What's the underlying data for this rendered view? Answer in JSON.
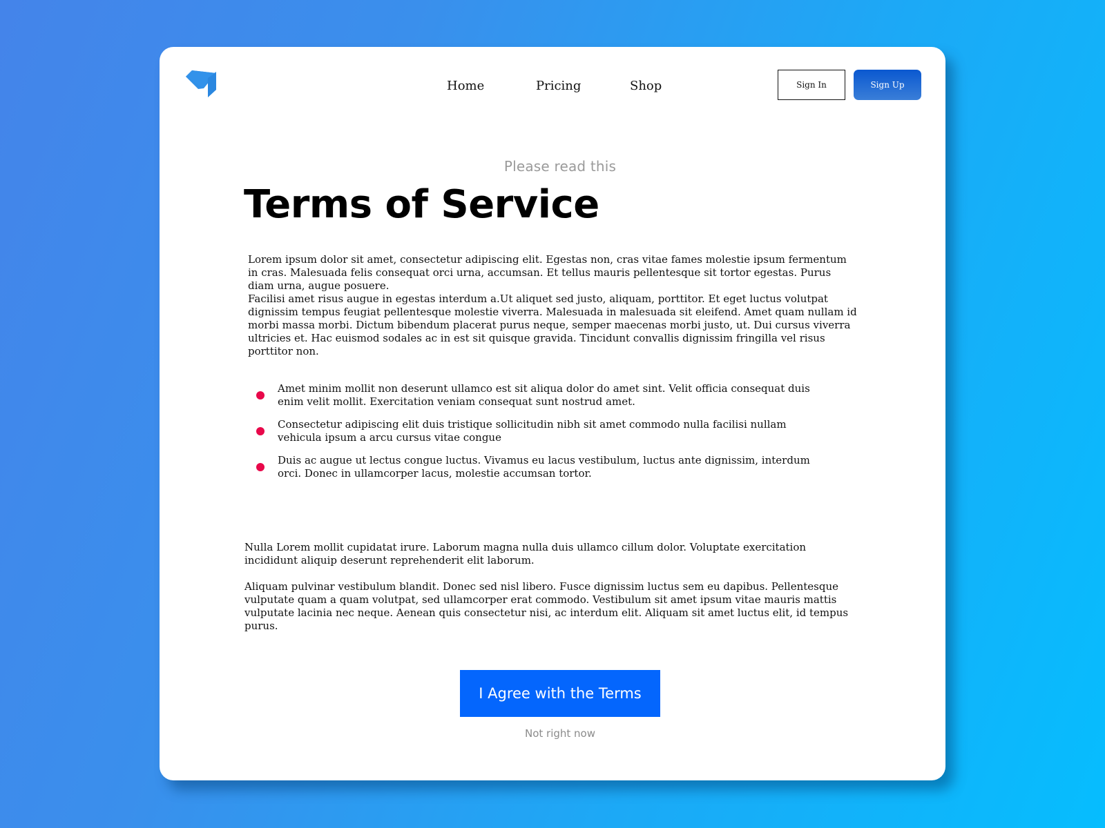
{
  "brand": {
    "logo_icon": "folded-paper-logo-icon",
    "logo_color": "#2e8fe8"
  },
  "nav": {
    "items": [
      {
        "label": "Home"
      },
      {
        "label": "Pricing"
      },
      {
        "label": "Shop"
      }
    ]
  },
  "auth": {
    "sign_in_label": "Sign In",
    "sign_up_label": "Sign Up"
  },
  "header": {
    "eyebrow": "Please read this",
    "title": "Terms of Service"
  },
  "content": {
    "intro_paragraphs": [
      "Lorem ipsum dolor sit amet, consectetur adipiscing elit. Egestas non, cras vitae fames molestie ipsum fermentum in cras. Malesuada felis consequat orci urna, accumsan. Et tellus mauris pellentesque sit tortor egestas. Purus diam urna, augue posuere.",
      "Facilisi amet risus augue in egestas interdum a.Ut aliquet sed justo, aliquam, porttitor. Et eget luctus volutpat dignissim tempus feugiat pellentesque molestie viverra. Malesuada in malesuada sit eleifend. Amet quam nullam id morbi massa morbi. Dictum bibendum placerat purus neque, semper maecenas morbi justo, ut. Dui cursus viverra ultricies et. Hac euismod sodales ac in est sit quisque gravida. Tincidunt convallis dignissim fringilla vel risus porttitor non."
    ],
    "bullets": [
      "Amet minim mollit non deserunt ullamco est sit aliqua dolor do amet sint. Velit officia consequat duis enim velit mollit. Exercitation veniam consequat sunt nostrud amet.",
      "Consectetur adipiscing elit duis tristique sollicitudin nibh sit amet commodo nulla facilisi nullam vehicula ipsum a arcu cursus vitae congue",
      "Duis ac augue ut lectus congue luctus. Vivamus eu lacus vestibulum, luctus ante dignissim, interdum orci. Donec in ullamcorper lacus, molestie accumsan tortor."
    ],
    "bullet_color": "#e8084a",
    "closing_paragraphs": [
      "Nulla Lorem mollit cupidatat irure. Laborum magna nulla duis ullamco cillum dolor. Voluptate exercitation incididunt aliquip deserunt reprehenderit elit laborum.",
      "Aliquam pulvinar vestibulum blandit. Donec sed nisl libero. Fusce dignissim luctus sem eu dapibus. Pellentesque vulputate quam a quam volutpat, sed ullamcorper erat commodo. Vestibulum sit amet ipsum vitae mauris mattis vulputate lacinia nec neque. Aenean quis consectetur nisi, ac interdum elit. Aliquam sit amet luctus elit, id tempus purus."
    ]
  },
  "actions": {
    "agree_label": "I Agree with the Terms",
    "decline_label": "Not right now",
    "accent_color": "#0466fd"
  }
}
